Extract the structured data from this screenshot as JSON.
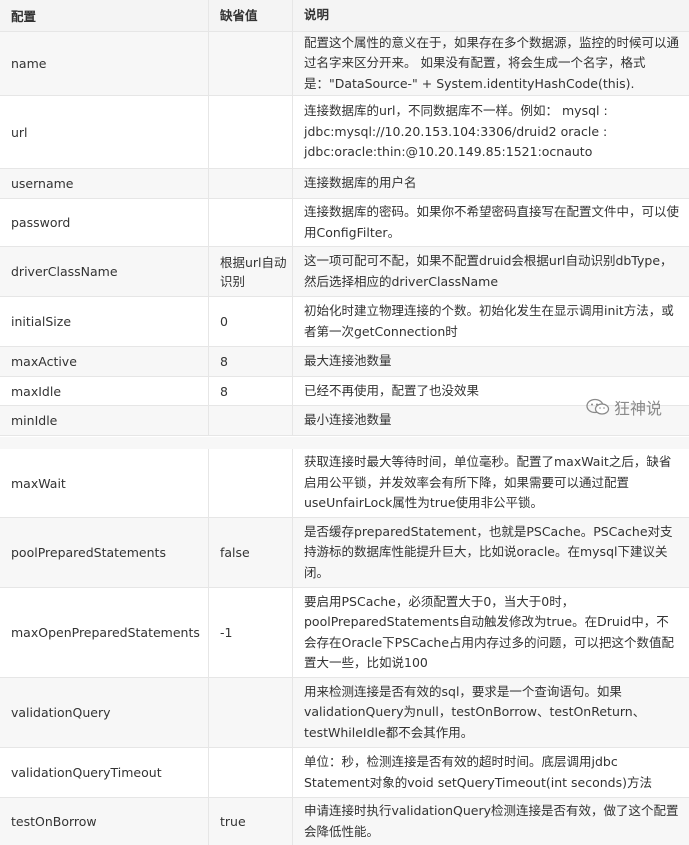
{
  "table": {
    "headers": [
      "配置",
      "缺省值",
      "说明"
    ],
    "rows": [
      {
        "name": "name",
        "default": "",
        "desc": "配置这个属性的意义在于，如果存在多个数据源，监控的时候可以通过名字来区分开来。 如果没有配置，将会生成一个名字，格式是：\"DataSource-\" + System.identityHashCode(this)."
      },
      {
        "name": "url",
        "default": "",
        "desc": "连接数据库的url，不同数据库不一样。例如： mysql : jdbc:mysql://10.20.153.104:3306/druid2  oracle : jdbc:oracle:thin:@10.20.149.85:1521:ocnauto"
      },
      {
        "name": "username",
        "default": "",
        "desc": "连接数据库的用户名"
      },
      {
        "name": "password",
        "default": "",
        "desc": "连接数据库的密码。如果你不希望密码直接写在配置文件中，可以使用ConfigFilter。"
      },
      {
        "name": "driverClassName",
        "default": "根据url自动识别",
        "desc": "这一项可配可不配，如果不配置druid会根据url自动识别dbType，然后选择相应的driverClassName"
      },
      {
        "name": "initialSize",
        "default": "0",
        "desc": "初始化时建立物理连接的个数。初始化发生在显示调用init方法，或者第一次getConnection时"
      },
      {
        "name": "maxActive",
        "default": "8",
        "desc": "最大连接池数量"
      },
      {
        "name": "maxIdle",
        "default": "8",
        "desc": "已经不再使用，配置了也没效果"
      },
      {
        "name": "minIdle",
        "default": "",
        "desc": "最小连接池数量"
      },
      {
        "name": "maxWait",
        "default": "",
        "desc": "获取连接时最大等待时间，单位毫秒。配置了maxWait之后，缺省启用公平锁，并发效率会有所下降，如果需要可以通过配置useUnfairLock属性为true使用非公平锁。"
      },
      {
        "name": "poolPreparedStatements",
        "default": "false",
        "desc": "是否缓存preparedStatement，也就是PSCache。PSCache对支持游标的数据库性能提升巨大，比如说oracle。在mysql下建议关闭。"
      },
      {
        "name": "maxOpenPreparedStatements",
        "default": "-1",
        "desc": "要启用PSCache，必须配置大于0，当大于0时，poolPreparedStatements自动触发修改为true。在Druid中，不会存在Oracle下PSCache占用内存过多的问题，可以把这个数值配置大一些，比如说100"
      },
      {
        "name": "validationQuery",
        "default": "",
        "desc": "用来检测连接是否有效的sql，要求是一个查询语句。如果validationQuery为null，testOnBorrow、testOnReturn、testWhileIdle都不会其作用。"
      },
      {
        "name": "validationQueryTimeout",
        "default": "",
        "desc": "单位：秒，检测连接是否有效的超时时间。底层调用jdbc Statement对象的void setQueryTimeout(int seconds)方法"
      },
      {
        "name": "testOnBorrow",
        "default": "true",
        "desc": "申请连接时执行validationQuery检测连接是否有效，做了这个配置会降低性能。"
      }
    ]
  },
  "watermark": {
    "text": "狂神说",
    "icon": "wechat-icon"
  },
  "colors": {
    "header_bg": "#f4f4f4",
    "stripe_bg": "#f7f7f7",
    "border": "#e6e6e6",
    "text": "#333333"
  }
}
